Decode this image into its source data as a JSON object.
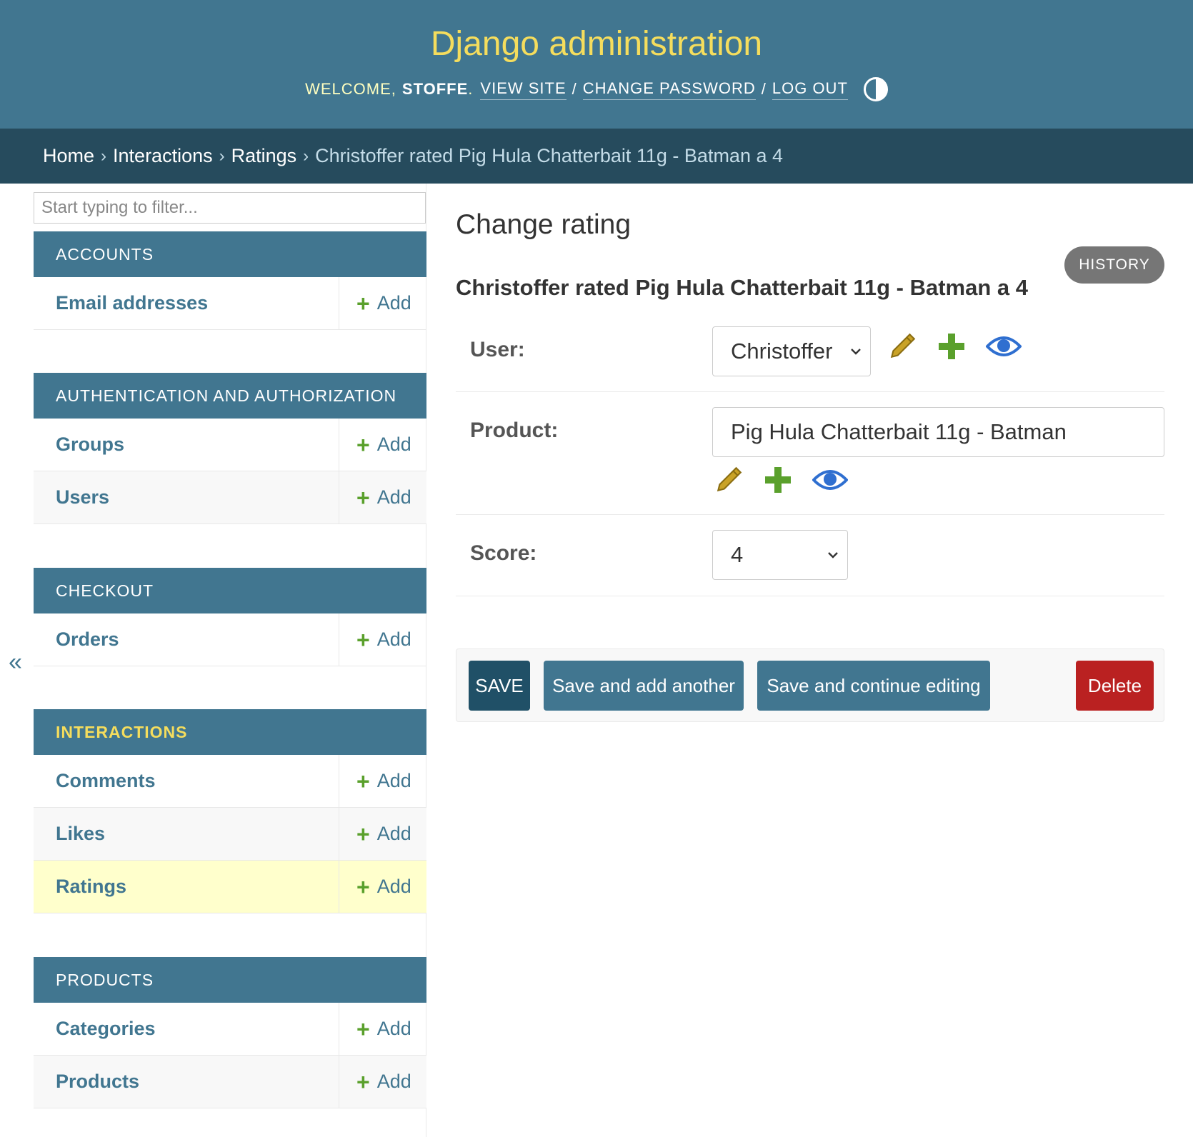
{
  "header": {
    "brand": "Django administration",
    "welcome": "WELCOME,",
    "username": "STOFFE",
    "period": ".",
    "view_site": "VIEW SITE",
    "change_password": "CHANGE PASSWORD",
    "log_out": "LOG OUT",
    "separator": "/",
    "theme_icon": "theme-toggle-icon"
  },
  "breadcrumbs": {
    "items": [
      "Home",
      "Interactions",
      "Ratings"
    ],
    "current": "Christoffer rated Pig Hula Chatterbait 11g - Batman a 4",
    "separator": "›"
  },
  "sidebar": {
    "filter_placeholder": "Start typing to filter...",
    "collapse_label": "«",
    "add_label": "Add",
    "apps": [
      {
        "name": "ACCOUNTS",
        "models": [
          "Email addresses"
        ]
      },
      {
        "name": "AUTHENTICATION AND AUTHORIZATION",
        "models": [
          "Groups",
          "Users"
        ]
      },
      {
        "name": "CHECKOUT",
        "models": [
          "Orders"
        ]
      },
      {
        "name": "INTERACTIONS",
        "models": [
          "Comments",
          "Likes",
          "Ratings"
        ]
      },
      {
        "name": "PRODUCTS",
        "models": [
          "Categories",
          "Products"
        ]
      }
    ]
  },
  "content": {
    "title": "Change rating",
    "history_label": "HISTORY",
    "object_title": "Christoffer rated Pig Hula Chatterbait 11g - Batman a 4",
    "fields": {
      "user": {
        "label": "User:",
        "value": "Christoffer"
      },
      "product": {
        "label": "Product:",
        "value": "Pig Hula Chatterbait 11g - Batman"
      },
      "score": {
        "label": "Score:",
        "value": "4"
      }
    },
    "buttons": {
      "save": "SAVE",
      "save_add": "Save and add another",
      "save_continue": "Save and continue editing",
      "delete": "Delete"
    }
  },
  "colors": {
    "header_bg": "#417690",
    "breadcrumb_bg": "#264b5d",
    "brand": "#f5dd5d",
    "add_green": "#5aa02c",
    "edit_gold": "#b8860b",
    "view_blue": "#2f6fd0",
    "delete_red": "#ba2121"
  }
}
